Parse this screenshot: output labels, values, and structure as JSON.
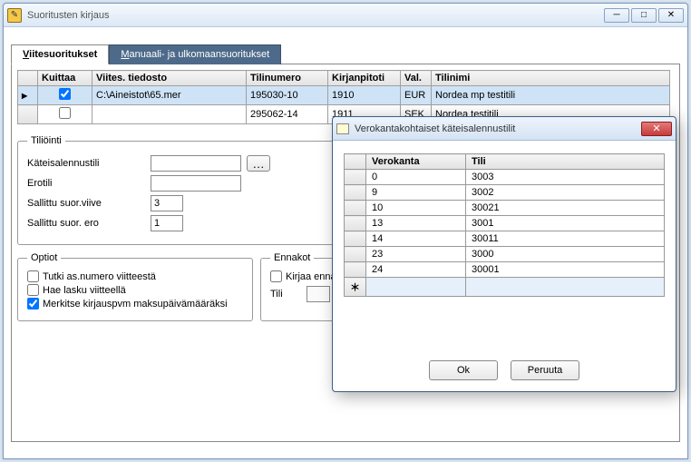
{
  "window": {
    "title": "Suoritusten kirjaus"
  },
  "tabs": {
    "viitesuoritukset": "Viitesuoritukset",
    "manuaali": "Manuaali- ja ulkomaansuoritukset"
  },
  "grid": {
    "headers": {
      "kuittaa": "Kuittaa",
      "viitestiedosto": "Viites. tiedosto",
      "tilinumero": "Tilinumero",
      "kirjanpitoti": "Kirjanpitoti",
      "val": "Val.",
      "tilinimi": "Tilinimi"
    },
    "rows": [
      {
        "kuittaa": true,
        "tiedosto": "C:\\Aineistot\\65.mer",
        "tilinumero": "195030-10",
        "kirjanpitoti": "1910",
        "val": "EUR",
        "tilinimi": "Nordea mp testitili"
      },
      {
        "kuittaa": false,
        "tiedosto": "",
        "tilinumero": "295062-14",
        "kirjanpitoti": "1911",
        "val": "SEK",
        "tilinimi": "Nordea testitili"
      }
    ]
  },
  "tiliointi": {
    "legend": "Tiliöinti",
    "labels": {
      "kateisalennustili": "Käteisalennustili",
      "erotili": "Erotili",
      "sallittuviive": "Sallittu suor.viive",
      "sallittuero": "Sallittu suor. ero"
    },
    "values": {
      "kateisalennustili": "",
      "erotili": "",
      "sallittuviive": "3",
      "sallittuero": "1"
    }
  },
  "optiot": {
    "legend": "Optiot",
    "tutki": "Tutki as.numero viitteestä",
    "hae": "Hae lasku viitteellä",
    "merkitse": "Merkitse kirjauspvm maksupäivämääräksi",
    "checked": {
      "tutki": false,
      "hae": false,
      "merkitse": true
    }
  },
  "ennakot": {
    "legend": "Ennakot",
    "kirjaa": "Kirjaa ennako",
    "tili": "Tili"
  },
  "modal": {
    "title": "Verokantakohtaiset käteisalennustilit",
    "headers": {
      "verokanta": "Verokanta",
      "tili": "Tili"
    },
    "rows": [
      {
        "verokanta": "0",
        "tili": "3003"
      },
      {
        "verokanta": "9",
        "tili": "3002"
      },
      {
        "verokanta": "10",
        "tili": "30021"
      },
      {
        "verokanta": "13",
        "tili": "3001"
      },
      {
        "verokanta": "14",
        "tili": "30011"
      },
      {
        "verokanta": "23",
        "tili": "3000"
      },
      {
        "verokanta": "24",
        "tili": "30001"
      }
    ],
    "buttons": {
      "ok": "Ok",
      "peruuta": "Peruuta"
    }
  }
}
